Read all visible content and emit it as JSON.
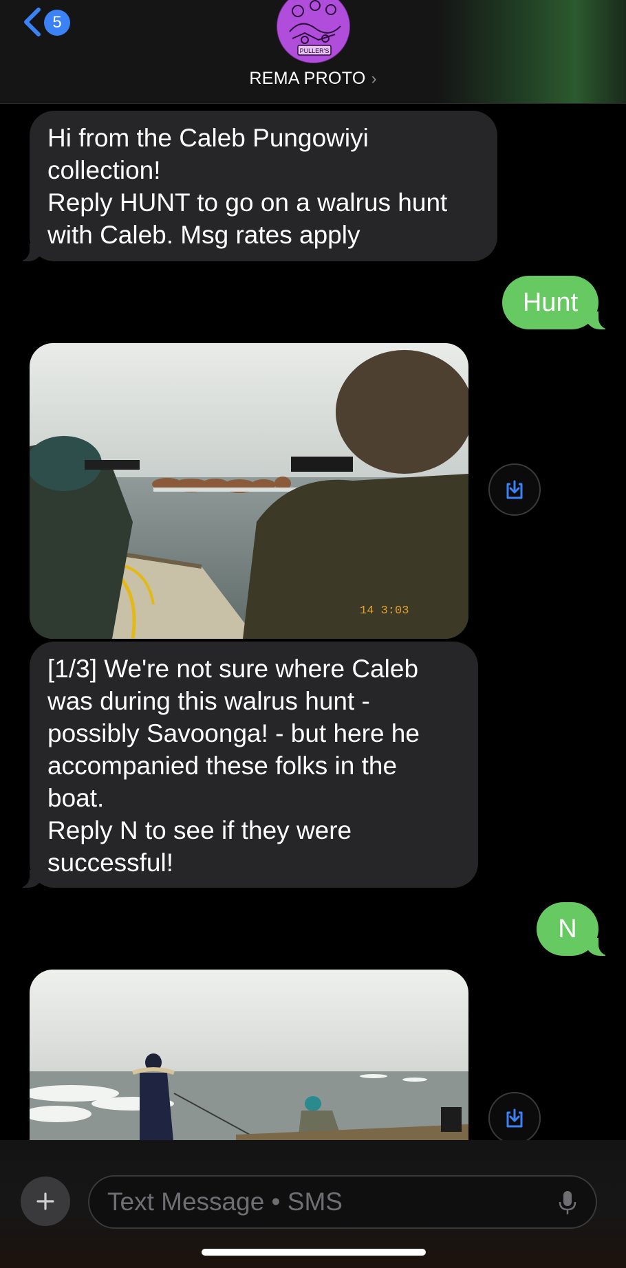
{
  "header": {
    "back_count": "5",
    "contact_name": "REMA PROTO",
    "chevron": "›",
    "avatar_text": "PULLER'S"
  },
  "messages": [
    {
      "direction": "incoming",
      "type": "text",
      "text": "Hi from the Caleb Pungowiyi collection!\nReply HUNT to go on a walrus hunt with Caleb. Msg rates apply"
    },
    {
      "direction": "outgoing",
      "type": "text",
      "text": "Hunt"
    },
    {
      "direction": "incoming",
      "type": "image",
      "image_stamp": "14  3:03",
      "image_desc": "walrus-hunt-boat-photo"
    },
    {
      "direction": "incoming",
      "type": "text",
      "text": "[1/3] We're not sure where Caleb was during this walrus hunt - possibly Savoonga! - but here he accompanied these folks in the boat.\nReply N to see if they were successful!"
    },
    {
      "direction": "outgoing",
      "type": "text",
      "text": "N"
    },
    {
      "direction": "incoming",
      "type": "image",
      "image_desc": "hunters-on-ice-photo"
    }
  ],
  "composer": {
    "placeholder": "Text Message • SMS"
  },
  "icons": {
    "back": "chevron-left-icon",
    "save": "download-icon",
    "add": "plus-icon",
    "mic": "microphone-icon"
  },
  "colors": {
    "accent": "#3b82f6",
    "outgoing_bubble": "#67c961",
    "incoming_bubble": "#262628",
    "background": "#000000"
  }
}
